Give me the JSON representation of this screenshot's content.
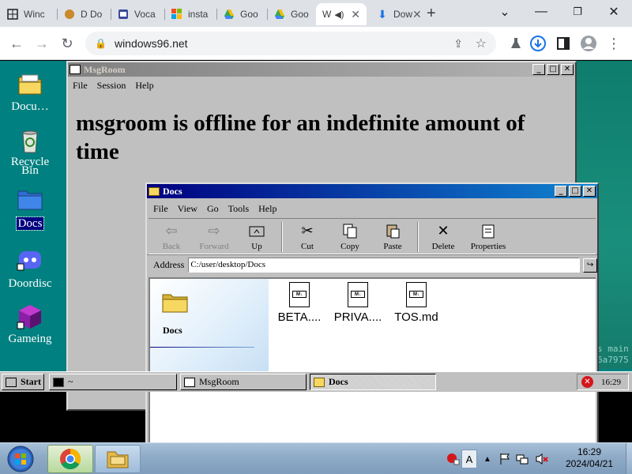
{
  "browser": {
    "tabs": [
      {
        "label": "Winc",
        "icon": "windows-icon"
      },
      {
        "label": "D Do",
        "icon": "dog-icon"
      },
      {
        "label": "Voca",
        "icon": "app-icon"
      },
      {
        "label": "insta",
        "icon": "microsoft-icon"
      },
      {
        "label": "Goo",
        "icon": "google-drive-icon"
      },
      {
        "label": "Goo",
        "icon": "google-drive-icon"
      },
      {
        "label": "W",
        "icon": "w-icon",
        "active": true
      },
      {
        "label": "Dow",
        "icon": "download-icon"
      }
    ],
    "url": "windows96.net"
  },
  "desktop_icons": [
    {
      "label": "Docu…"
    },
    {
      "label": "Recycle Bin"
    },
    {
      "label": "Docs",
      "selected": true
    },
    {
      "label": "Doordisc"
    },
    {
      "label": "Gameing"
    }
  ],
  "msgroom": {
    "title": "MsgRoom",
    "menu": [
      "File",
      "Session",
      "Help"
    ],
    "message": "msgroom is offline for an indefinite amount of time"
  },
  "explorer": {
    "title": "Docs",
    "menu": [
      "File",
      "View",
      "Go",
      "Tools",
      "Help"
    ],
    "toolbar": [
      {
        "label": "Back",
        "disabled": true
      },
      {
        "label": "Forward",
        "disabled": true
      },
      {
        "label": "Up"
      },
      {
        "label": "Cut"
      },
      {
        "label": "Copy"
      },
      {
        "label": "Paste"
      },
      {
        "label": "Delete"
      },
      {
        "label": "Properties"
      }
    ],
    "address_label": "Address",
    "address": "C:/user/desktop/Docs",
    "folder_label": "Docs",
    "files": [
      "BETA....",
      "PRIVA....",
      "TOS.md"
    ],
    "file_badge": "M↓"
  },
  "taskbar98": {
    "start": "Start",
    "tasks": [
      "~",
      "MsgRoom",
      "Docs"
    ],
    "clock": "16:29"
  },
  "background_text": [
    "s main",
    "6a7975"
  ],
  "win7": {
    "time": "16:29",
    "date": "2024/04/21",
    "ime": "A"
  }
}
